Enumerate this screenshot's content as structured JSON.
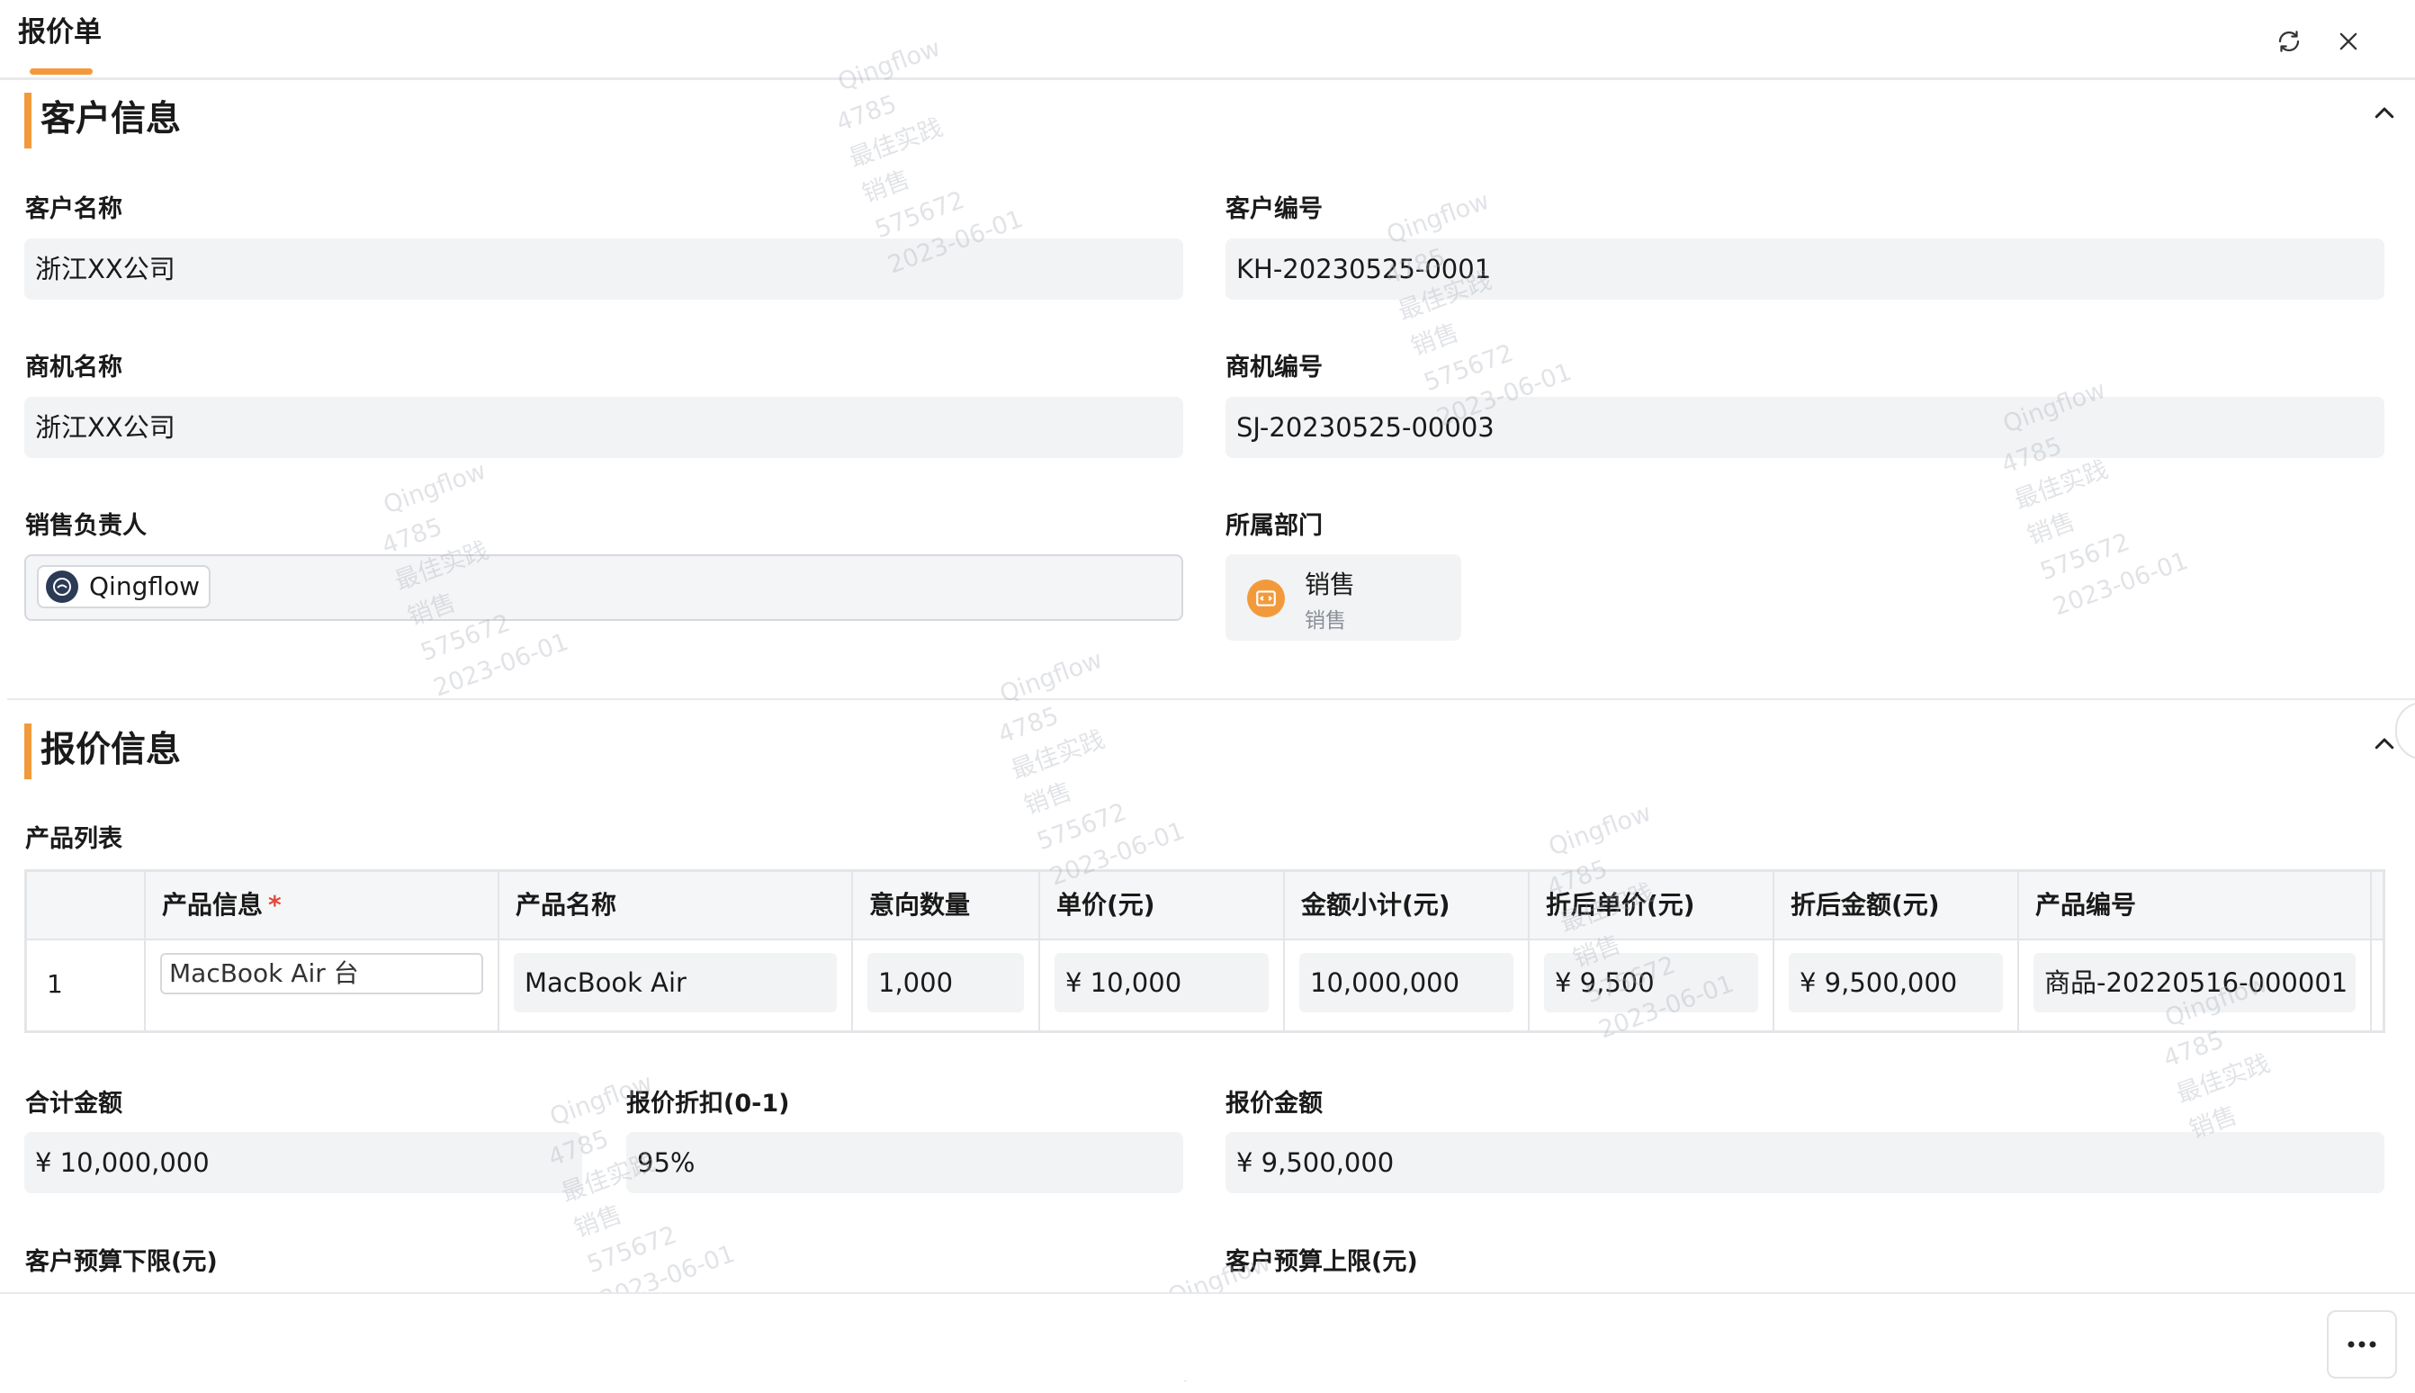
{
  "header": {
    "title": "报价单"
  },
  "icons": {
    "refresh": "refresh-icon",
    "close": "close-icon",
    "collapse": "chevron-up-icon",
    "more": "more-icon"
  },
  "accent_color": "#f29a3b",
  "customer_section": {
    "title": "客户信息",
    "customer_name": {
      "label": "客户名称",
      "value": "浙江XX公司"
    },
    "customer_no": {
      "label": "客户编号",
      "value": "KH-20230525-0001"
    },
    "opportunity_name": {
      "label": "商机名称",
      "value": "浙江XX公司"
    },
    "opportunity_no": {
      "label": "商机编号",
      "value": "SJ-20230525-00003"
    },
    "sales_owner": {
      "label": "销售负责人",
      "value": "Qingflow"
    },
    "department": {
      "label": "所属部门",
      "name": "销售",
      "sub": "销售"
    }
  },
  "quote_section": {
    "title": "报价信息",
    "product_list_label": "产品列表",
    "table": {
      "headers": [
        "产品信息",
        "产品名称",
        "意向数量",
        "单价(元)",
        "金额小计(元)",
        "折后单价(元)",
        "折后金额(元)",
        "产品编号"
      ],
      "required_mark": "*",
      "rows": [
        {
          "index": "1",
          "product_info": "MacBook Air 台",
          "product_name": "MacBook Air",
          "quantity": "1,000",
          "unit_price": "¥ 10,000",
          "subtotal": "10,000,000",
          "discount_unit_price": "¥ 9,500",
          "discount_amount": "¥ 9,500,000",
          "product_no": "商品-20220516-000001"
        }
      ]
    },
    "total_amount": {
      "label": "合计金额",
      "value": "¥ 10,000,000"
    },
    "discount": {
      "label": "报价折扣(0-1)",
      "value": "95%"
    },
    "quote_amount": {
      "label": "报价金额",
      "value": "¥ 9,500,000"
    },
    "budget_min": {
      "label": "客户预算下限(元)"
    },
    "budget_max": {
      "label": "客户预算上限(元)"
    }
  },
  "watermark": {
    "lines": [
      "Qingflow",
      "4785",
      "最佳实践",
      "销售",
      "575672",
      "2023-06-01"
    ]
  }
}
